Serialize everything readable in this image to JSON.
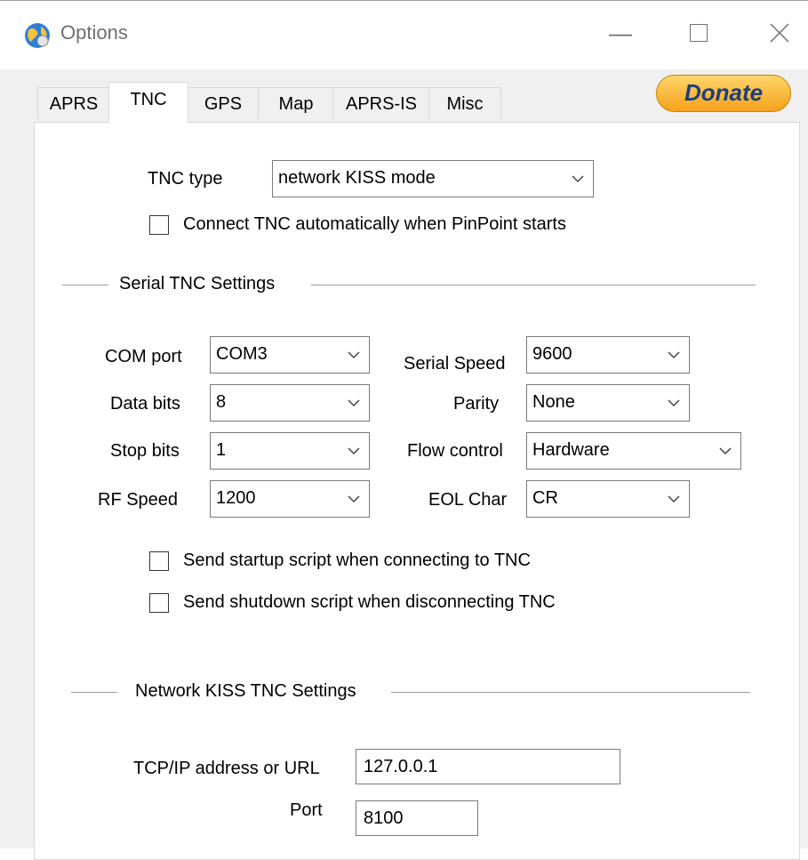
{
  "window": {
    "title": "Options",
    "icon": "globe-icon"
  },
  "tabs": [
    {
      "label": "APRS"
    },
    {
      "label": "TNC",
      "active": true
    },
    {
      "label": "GPS"
    },
    {
      "label": "Map"
    },
    {
      "label": "APRS-IS"
    },
    {
      "label": "Misc"
    }
  ],
  "donate_label": "Donate",
  "tnc": {
    "type_label": "TNC type",
    "type_value": "network KISS mode",
    "auto_connect_label": "Connect TNC automatically when PinPoint starts",
    "auto_connect_checked": false
  },
  "serial": {
    "section_title": "Serial TNC Settings",
    "com_port_label": "COM port",
    "com_port_value": "COM3",
    "data_bits_label": "Data bits",
    "data_bits_value": "8",
    "stop_bits_label": "Stop bits",
    "stop_bits_value": "1",
    "rf_speed_label": "RF Speed",
    "rf_speed_value": "1200",
    "serial_speed_label": "Serial Speed",
    "serial_speed_value": "9600",
    "parity_label": "Parity",
    "parity_value": "None",
    "flow_control_label": "Flow control",
    "flow_control_value": "Hardware",
    "eol_label": "EOL Char",
    "eol_value": "CR",
    "startup_script_label": "Send startup script when connecting to TNC",
    "shutdown_script_label": "Send shutdown script when disconnecting TNC"
  },
  "network": {
    "section_title": "Network KISS TNC Settings",
    "address_label": "TCP/IP address or URL",
    "address_value": "127.0.0.1",
    "port_label": "Port",
    "port_value": "8100"
  }
}
